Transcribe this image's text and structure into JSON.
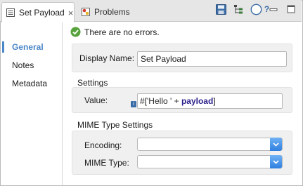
{
  "tabs": [
    {
      "label": "Set Payload",
      "active": true,
      "close": "×"
    },
    {
      "label": "Problems",
      "active": false
    }
  ],
  "toolbar": {
    "icons": [
      "save-icon",
      "tree-icon",
      "help-icon",
      "minimize-icon",
      "maximize-icon"
    ],
    "help_glyph": "?"
  },
  "nav": {
    "items": [
      {
        "label": "General",
        "selected": true
      },
      {
        "label": "Notes",
        "selected": false
      },
      {
        "label": "Metadata",
        "selected": false
      }
    ]
  },
  "status": {
    "text": "There are no errors.",
    "color": "#57a23b"
  },
  "general": {
    "display_name_label": "Display Name:",
    "display_name_value": "Set Payload"
  },
  "settings": {
    "title": "Settings",
    "value_label": "Value:",
    "expr_prefix": "#[",
    "expr_string": "'Hello ' + ",
    "expr_keyword": "payload",
    "expr_suffix": "]",
    "badge": "i"
  },
  "mime": {
    "title": "MIME Type Settings",
    "encoding_label": "Encoding:",
    "encoding_value": "",
    "mime_type_label": "MIME Type:",
    "mime_type_value": ""
  },
  "colors": {
    "accent": "#4a87c8",
    "keyword": "#2a1f8a",
    "dropdown": "#2f7fe0"
  }
}
